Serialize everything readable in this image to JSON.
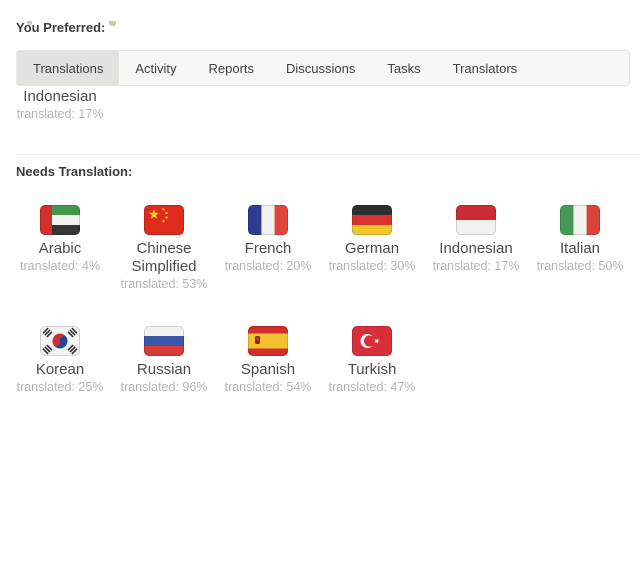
{
  "tabs": {
    "items": [
      {
        "label": "Translations",
        "active": true
      },
      {
        "label": "Activity",
        "active": false
      },
      {
        "label": "Reports",
        "active": false
      },
      {
        "label": "Discussions",
        "active": false
      },
      {
        "label": "Tasks",
        "active": false
      },
      {
        "label": "Translators",
        "active": false
      }
    ]
  },
  "preferred": {
    "heading": "You Preferred:",
    "languages": [
      {
        "name": "Indonesian",
        "flag": "indonesia",
        "translated_pct": 17,
        "translated_label": "translated: 17%"
      }
    ]
  },
  "needs_translation": {
    "heading": "Needs Translation:",
    "languages": [
      {
        "name": "Arabic",
        "flag": "uae",
        "translated_pct": 4,
        "translated_label": "translated: 4%"
      },
      {
        "name": "Chinese Simplified",
        "flag": "china",
        "translated_pct": 53,
        "translated_label": "translated: 53%"
      },
      {
        "name": "French",
        "flag": "france",
        "translated_pct": 20,
        "translated_label": "translated: 20%"
      },
      {
        "name": "German",
        "flag": "germany",
        "translated_pct": 30,
        "translated_label": "translated: 30%"
      },
      {
        "name": "Indonesian",
        "flag": "indonesia",
        "translated_pct": 17,
        "translated_label": "translated: 17%"
      },
      {
        "name": "Italian",
        "flag": "italy",
        "translated_pct": 50,
        "translated_label": "translated: 50%"
      },
      {
        "name": "Korean",
        "flag": "south-korea",
        "translated_pct": 25,
        "translated_label": "translated: 25%"
      },
      {
        "name": "Russian",
        "flag": "russia",
        "translated_pct": 96,
        "translated_label": "translated: 96%"
      },
      {
        "name": "Spanish",
        "flag": "spain",
        "translated_pct": 54,
        "translated_label": "translated: 54%"
      },
      {
        "name": "Turkish",
        "flag": "turkey",
        "translated_pct": 47,
        "translated_label": "translated: 47%"
      }
    ]
  },
  "colors": {
    "page_background": "#ffffff",
    "tabbar_background": "#f7f7f5",
    "tabbar_border": "#e7e7e4",
    "active_tab_background": "#e3e3de",
    "tab_text": "#40403c",
    "heading_text": "#3c3c38",
    "language_name_text": "#4b4b47",
    "translated_text": "#b4b4b0",
    "divider": "#eeeeec"
  }
}
